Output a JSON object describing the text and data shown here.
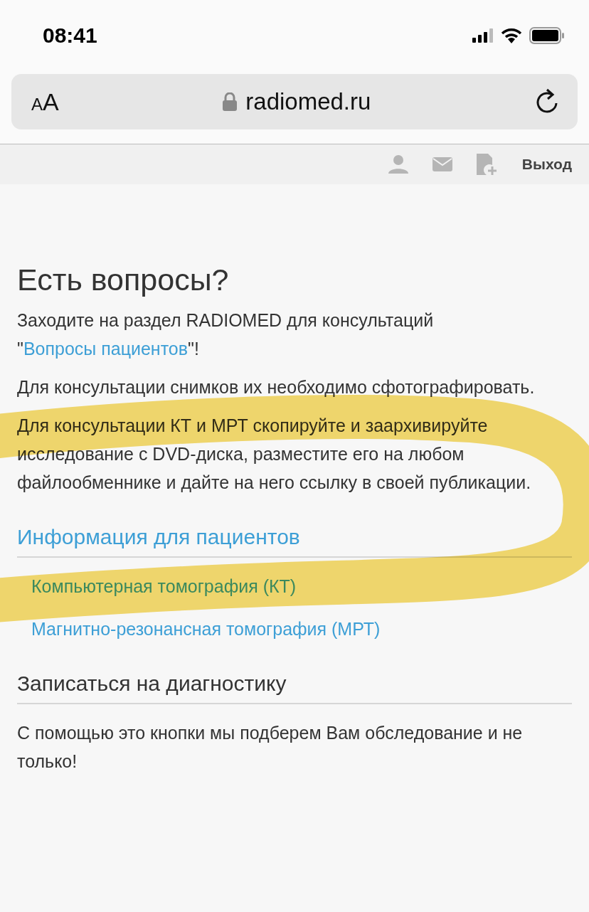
{
  "status_bar": {
    "time": "08:41"
  },
  "browser": {
    "text_size_button": "AA",
    "address": "radiomed.ru"
  },
  "toolbar": {
    "logout": "Выход"
  },
  "questions": {
    "title": "Есть вопросы?",
    "intro": "Заходите на раздел RADIOMED для консультаций \"",
    "intro_link": "Вопросы пациентов",
    "intro_end": "\"!",
    "paragraphs": [
      "Для консультации снимков их необходимо сфотографировать.",
      "Для консультации КТ и МРТ скопируйте и заархивируйте исследование с DVD-диска, разместите его на любом файлообменнике и дайте на него ссылку в своей публикации."
    ]
  },
  "patients": {
    "title": "Информация для пациентов",
    "links": [
      "Компьютерная томография (КТ)",
      "Магнитно-резонансная томография (МРТ)"
    ]
  },
  "signup": {
    "title": "Записаться на диагностику",
    "text": "С помощью это кнопки мы подберем Вам обследование и не только!"
  },
  "annotation": {
    "kind": "highlighter"
  }
}
